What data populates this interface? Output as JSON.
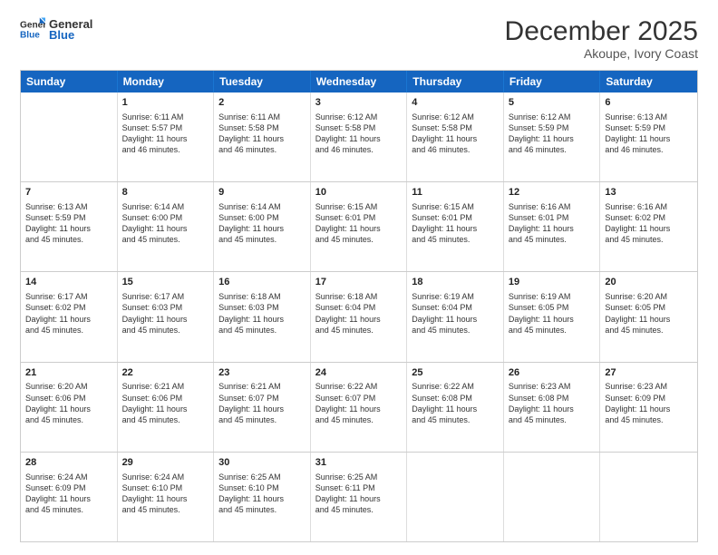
{
  "header": {
    "logo_line1": "General",
    "logo_line2": "Blue",
    "month": "December 2025",
    "location": "Akoupe, Ivory Coast"
  },
  "days_of_week": [
    "Sunday",
    "Monday",
    "Tuesday",
    "Wednesday",
    "Thursday",
    "Friday",
    "Saturday"
  ],
  "rows": [
    [
      {
        "day": "",
        "info": ""
      },
      {
        "day": "1",
        "info": "Sunrise: 6:11 AM\nSunset: 5:57 PM\nDaylight: 11 hours\nand 46 minutes."
      },
      {
        "day": "2",
        "info": "Sunrise: 6:11 AM\nSunset: 5:58 PM\nDaylight: 11 hours\nand 46 minutes."
      },
      {
        "day": "3",
        "info": "Sunrise: 6:12 AM\nSunset: 5:58 PM\nDaylight: 11 hours\nand 46 minutes."
      },
      {
        "day": "4",
        "info": "Sunrise: 6:12 AM\nSunset: 5:58 PM\nDaylight: 11 hours\nand 46 minutes."
      },
      {
        "day": "5",
        "info": "Sunrise: 6:12 AM\nSunset: 5:59 PM\nDaylight: 11 hours\nand 46 minutes."
      },
      {
        "day": "6",
        "info": "Sunrise: 6:13 AM\nSunset: 5:59 PM\nDaylight: 11 hours\nand 46 minutes."
      }
    ],
    [
      {
        "day": "7",
        "info": "Sunrise: 6:13 AM\nSunset: 5:59 PM\nDaylight: 11 hours\nand 45 minutes."
      },
      {
        "day": "8",
        "info": "Sunrise: 6:14 AM\nSunset: 6:00 PM\nDaylight: 11 hours\nand 45 minutes."
      },
      {
        "day": "9",
        "info": "Sunrise: 6:14 AM\nSunset: 6:00 PM\nDaylight: 11 hours\nand 45 minutes."
      },
      {
        "day": "10",
        "info": "Sunrise: 6:15 AM\nSunset: 6:01 PM\nDaylight: 11 hours\nand 45 minutes."
      },
      {
        "day": "11",
        "info": "Sunrise: 6:15 AM\nSunset: 6:01 PM\nDaylight: 11 hours\nand 45 minutes."
      },
      {
        "day": "12",
        "info": "Sunrise: 6:16 AM\nSunset: 6:01 PM\nDaylight: 11 hours\nand 45 minutes."
      },
      {
        "day": "13",
        "info": "Sunrise: 6:16 AM\nSunset: 6:02 PM\nDaylight: 11 hours\nand 45 minutes."
      }
    ],
    [
      {
        "day": "14",
        "info": "Sunrise: 6:17 AM\nSunset: 6:02 PM\nDaylight: 11 hours\nand 45 minutes."
      },
      {
        "day": "15",
        "info": "Sunrise: 6:17 AM\nSunset: 6:03 PM\nDaylight: 11 hours\nand 45 minutes."
      },
      {
        "day": "16",
        "info": "Sunrise: 6:18 AM\nSunset: 6:03 PM\nDaylight: 11 hours\nand 45 minutes."
      },
      {
        "day": "17",
        "info": "Sunrise: 6:18 AM\nSunset: 6:04 PM\nDaylight: 11 hours\nand 45 minutes."
      },
      {
        "day": "18",
        "info": "Sunrise: 6:19 AM\nSunset: 6:04 PM\nDaylight: 11 hours\nand 45 minutes."
      },
      {
        "day": "19",
        "info": "Sunrise: 6:19 AM\nSunset: 6:05 PM\nDaylight: 11 hours\nand 45 minutes."
      },
      {
        "day": "20",
        "info": "Sunrise: 6:20 AM\nSunset: 6:05 PM\nDaylight: 11 hours\nand 45 minutes."
      }
    ],
    [
      {
        "day": "21",
        "info": "Sunrise: 6:20 AM\nSunset: 6:06 PM\nDaylight: 11 hours\nand 45 minutes."
      },
      {
        "day": "22",
        "info": "Sunrise: 6:21 AM\nSunset: 6:06 PM\nDaylight: 11 hours\nand 45 minutes."
      },
      {
        "day": "23",
        "info": "Sunrise: 6:21 AM\nSunset: 6:07 PM\nDaylight: 11 hours\nand 45 minutes."
      },
      {
        "day": "24",
        "info": "Sunrise: 6:22 AM\nSunset: 6:07 PM\nDaylight: 11 hours\nand 45 minutes."
      },
      {
        "day": "25",
        "info": "Sunrise: 6:22 AM\nSunset: 6:08 PM\nDaylight: 11 hours\nand 45 minutes."
      },
      {
        "day": "26",
        "info": "Sunrise: 6:23 AM\nSunset: 6:08 PM\nDaylight: 11 hours\nand 45 minutes."
      },
      {
        "day": "27",
        "info": "Sunrise: 6:23 AM\nSunset: 6:09 PM\nDaylight: 11 hours\nand 45 minutes."
      }
    ],
    [
      {
        "day": "28",
        "info": "Sunrise: 6:24 AM\nSunset: 6:09 PM\nDaylight: 11 hours\nand 45 minutes."
      },
      {
        "day": "29",
        "info": "Sunrise: 6:24 AM\nSunset: 6:10 PM\nDaylight: 11 hours\nand 45 minutes."
      },
      {
        "day": "30",
        "info": "Sunrise: 6:25 AM\nSunset: 6:10 PM\nDaylight: 11 hours\nand 45 minutes."
      },
      {
        "day": "31",
        "info": "Sunrise: 6:25 AM\nSunset: 6:11 PM\nDaylight: 11 hours\nand 45 minutes."
      },
      {
        "day": "",
        "info": ""
      },
      {
        "day": "",
        "info": ""
      },
      {
        "day": "",
        "info": ""
      }
    ]
  ]
}
